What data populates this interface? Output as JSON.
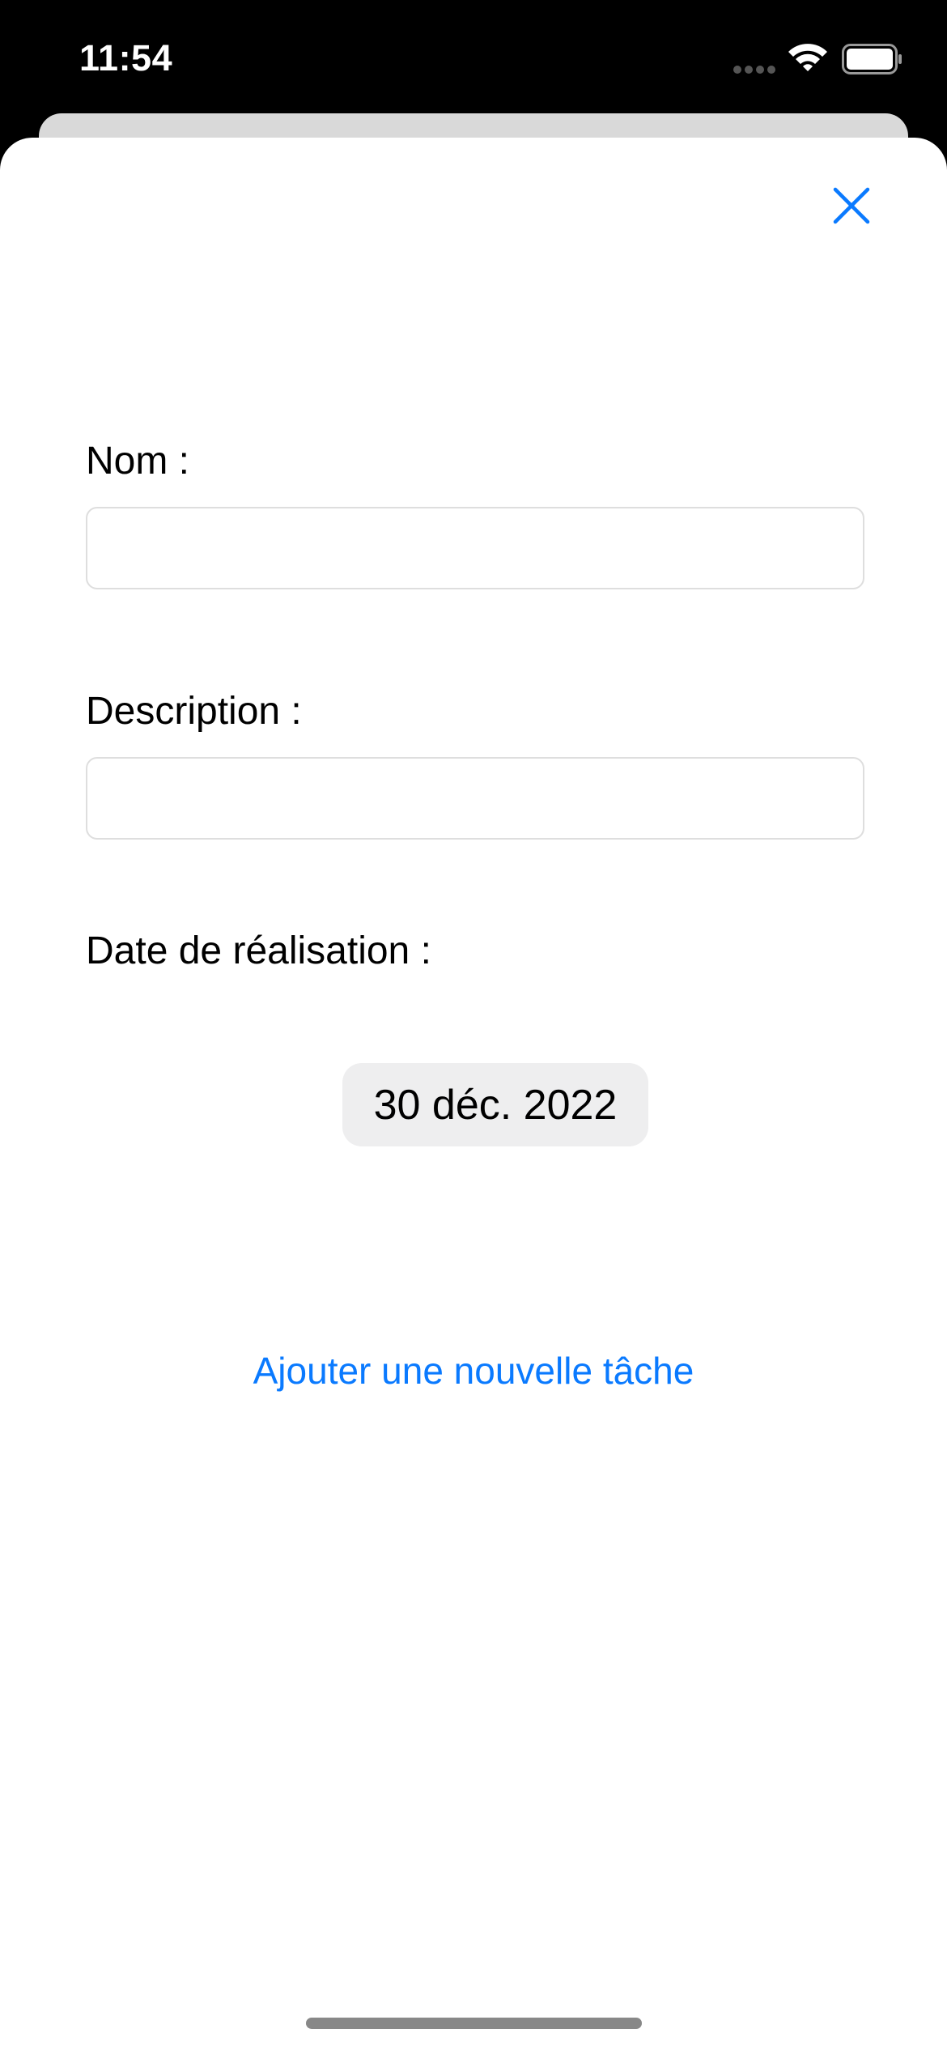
{
  "status_bar": {
    "time": "11:54",
    "icons": [
      "signal-icon",
      "wifi-icon",
      "battery-icon"
    ]
  },
  "sheet": {
    "close_icon": "close-icon",
    "accent_color": "#0a7aff"
  },
  "form": {
    "name_label": "Nom :",
    "name_value": "",
    "description_label": "Description :",
    "description_value": "",
    "date_label": "Date de réalisation :",
    "date_value": "30 déc. 2022",
    "submit_label": "Ajouter une nouvelle tâche"
  }
}
